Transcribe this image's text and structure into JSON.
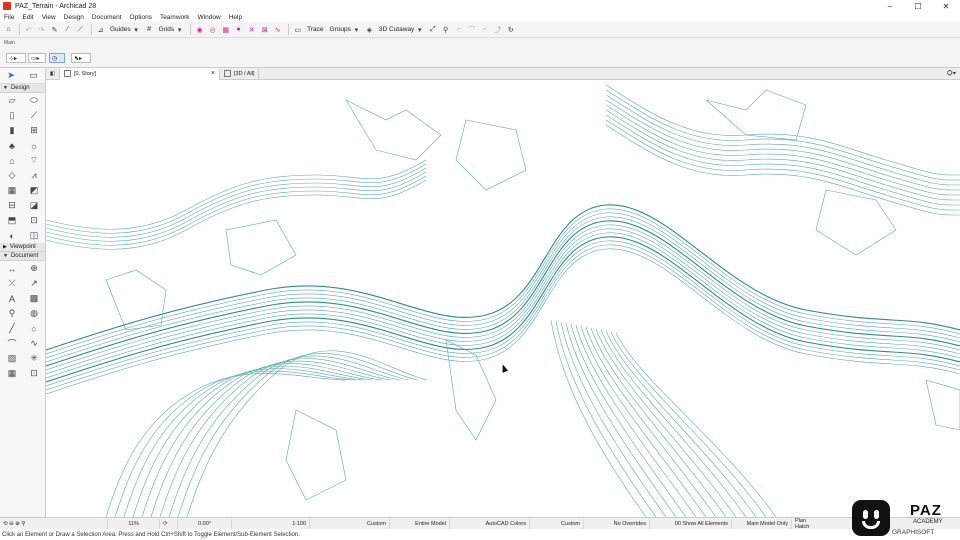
{
  "window": {
    "title": "PAZ_Terrain - Archicad 28"
  },
  "menu": [
    "File",
    "Edit",
    "View",
    "Design",
    "Document",
    "Options",
    "Teamwork",
    "Window",
    "Help"
  ],
  "toolbar": {
    "guides": "Guides",
    "grids": "Grids",
    "trace": "Trace",
    "groups": "Groups",
    "cutaway": "3D Cutaway"
  },
  "infobox": {
    "label": "Main"
  },
  "toolbox": {
    "design": "Design",
    "viewpoint": "Viewpoint",
    "document": "Document"
  },
  "tabs": [
    {
      "label": "[0. Story]"
    },
    {
      "label": "[3D / All]"
    }
  ],
  "status": {
    "zoom": "11%",
    "angle": "0.00°",
    "scale": "1:100",
    "layer": "Custom",
    "model": "Entire Model",
    "pen": "AutoCAD Colors",
    "graphic": "Custom",
    "overrides": "No Overrides",
    "renovation": "00 Show All Elements",
    "mvo": "Main Model Only",
    "mvo_tail": "Plan Hatch"
  },
  "hint": "Click an Element or Draw a Selection Area. Press and Hold Ctrl+Shift to Toggle Element/Sub-Element Selection.",
  "logo": {
    "brand": "PAZ",
    "sub": "ACADEMY",
    "partner": "GRAPHISOFT"
  },
  "colors": {
    "contour": "#5aa7b4",
    "contour_strong": "#2f8794",
    "accent": "#e0301e"
  }
}
